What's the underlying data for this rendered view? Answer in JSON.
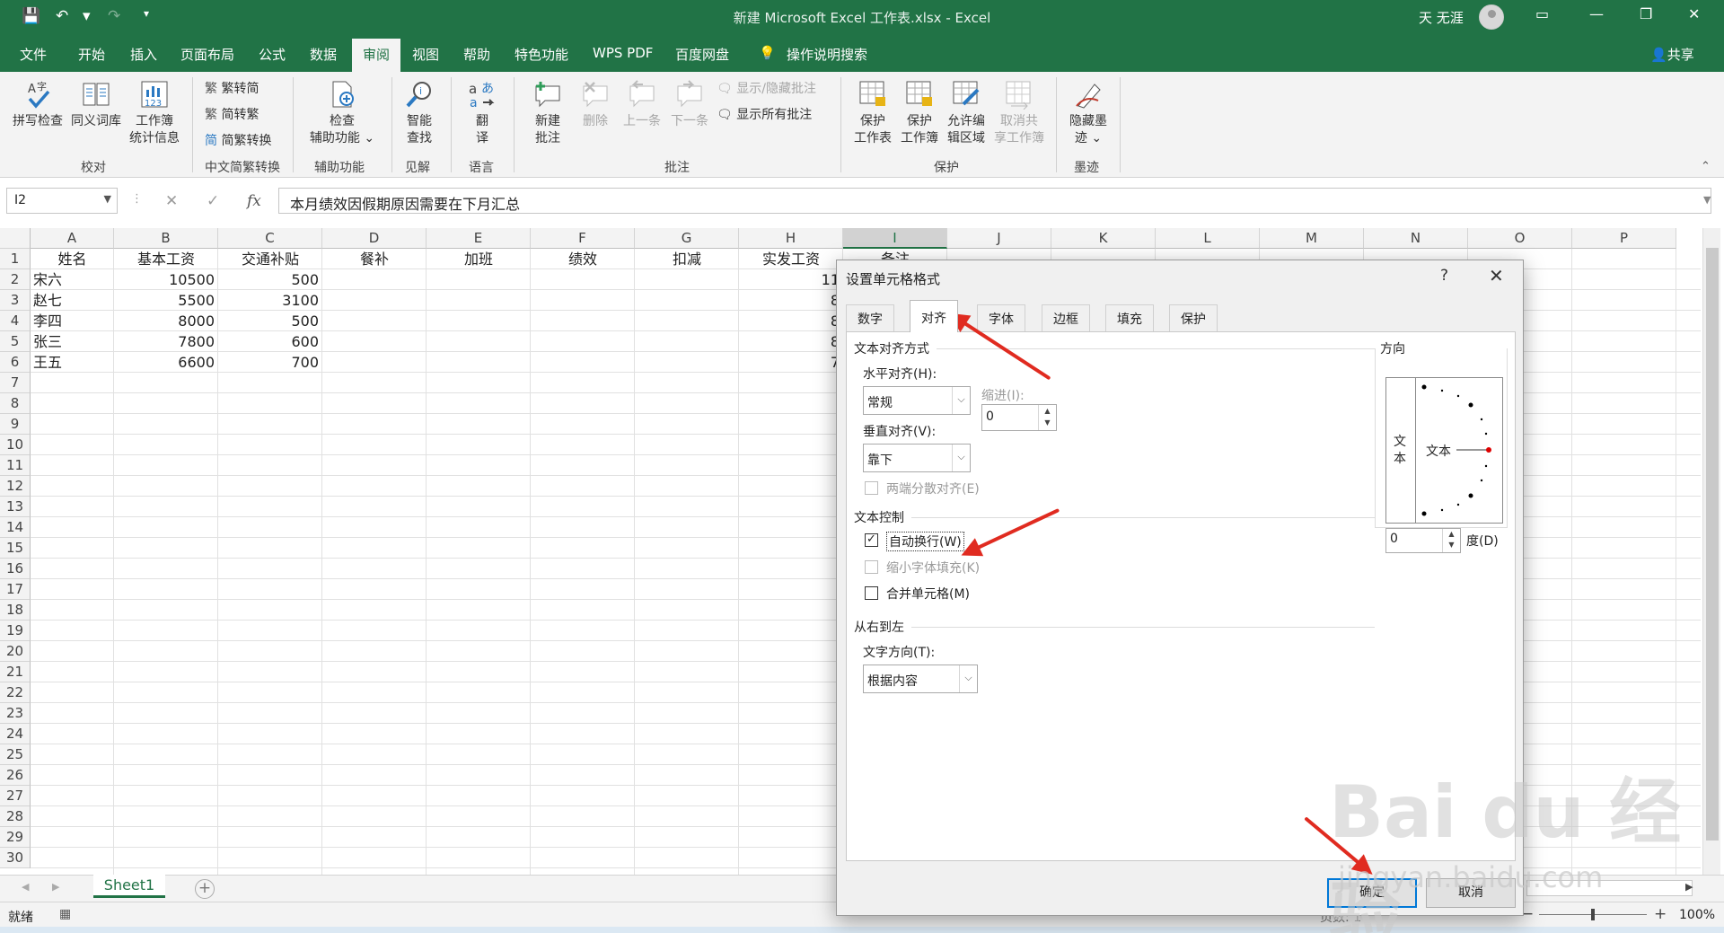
{
  "titlebar": {
    "title": "新建 Microsoft Excel 工作表.xlsx  -  Excel",
    "user": "天 无涯",
    "save_icon": "save-icon",
    "undo_icon": "undo-icon",
    "redo_icon": "redo-icon"
  },
  "menu": {
    "tabs": [
      "文件",
      "开始",
      "插入",
      "页面布局",
      "公式",
      "数据",
      "审阅",
      "视图",
      "帮助",
      "特色功能",
      "WPS PDF",
      "百度网盘"
    ],
    "active": "审阅",
    "tell_me": "操作说明搜索",
    "share": "共享"
  },
  "ribbon": {
    "proofing": {
      "spell": "拼写检查",
      "thesaurus": "同义词库",
      "stats_line1": "工作簿",
      "stats_line2": "统计信息",
      "group": "校对"
    },
    "chinese": {
      "t2s": "繁转简",
      "s2t": "简转繁",
      "convert": "简繁转换",
      "group": "中文简繁转换"
    },
    "access": {
      "line1": "检查",
      "line2": "辅助功能 ⌄",
      "group": "辅助功能"
    },
    "insights": {
      "line1": "智能",
      "line2": "查找",
      "group": "见解"
    },
    "language": {
      "line1": "翻",
      "line2": "译",
      "group": "语言"
    },
    "comments": {
      "new1": "新建",
      "new2": "批注",
      "delete": "删除",
      "prev": "上一条",
      "next": "下一条",
      "toggle": "显示/隐藏批注",
      "showall": "显示所有批注",
      "group": "批注"
    },
    "protect": {
      "sheet1": "保护",
      "sheet2": "工作表",
      "book1": "保护",
      "book2": "工作簿",
      "edit1": "允许编",
      "edit2": "辑区域",
      "unshare1": "取消共",
      "unshare2": "享工作簿",
      "group": "保护"
    },
    "ink": {
      "line1": "隐藏墨",
      "line2": "迹 ⌄",
      "group": "墨迹"
    }
  },
  "formula_bar": {
    "name_box": "I2",
    "cancel": "✕",
    "enter": "✓",
    "fx": "fx",
    "content": "本月绩效因假期原因需要在下月汇总"
  },
  "sheet": {
    "columns": [
      "A",
      "B",
      "C",
      "D",
      "E",
      "F",
      "G",
      "H",
      "I",
      "J",
      "K",
      "L",
      "M",
      "N",
      "O",
      "P"
    ],
    "headers": [
      "姓名",
      "基本工资",
      "交通补贴",
      "餐补",
      "加班",
      "绩效",
      "扣减",
      "实发工资",
      "备注"
    ],
    "rows": [
      [
        "宋六",
        "10500",
        "500",
        "11"
      ],
      [
        "赵七",
        "5500",
        "3100",
        "8"
      ],
      [
        "李四",
        "8000",
        "500",
        "8"
      ],
      [
        "张三",
        "7800",
        "600",
        "8"
      ],
      [
        "王五",
        "6600",
        "700",
        "7"
      ]
    ],
    "row_numbers": [
      "1",
      "2",
      "3",
      "4",
      "5",
      "6",
      "7",
      "8",
      "9",
      "10",
      "11",
      "12",
      "13",
      "14",
      "15",
      "16",
      "17",
      "18",
      "19",
      "20",
      "21",
      "22",
      "23",
      "24",
      "25",
      "26",
      "27",
      "28",
      "29",
      "30"
    ]
  },
  "sheet_tabs": {
    "active": "Sheet1",
    "add": "+"
  },
  "status": {
    "ready": "就绪",
    "page": "页数: 1",
    "zoom": "100%"
  },
  "dialog": {
    "title": "设置单元格格式",
    "help": "?",
    "close": "✕",
    "tabs": [
      "数字",
      "对齐",
      "字体",
      "边框",
      "填充",
      "保护"
    ],
    "active_tab": "对齐",
    "text_align": {
      "section": "文本对齐方式",
      "horizontal_label": "水平对齐(H):",
      "horizontal_value": "常规",
      "indent_label": "缩进(I):",
      "indent_value": "0",
      "vertical_label": "垂直对齐(V):",
      "vertical_value": "靠下",
      "distributed": "两端分散对齐(E)"
    },
    "text_control": {
      "section": "文本控制",
      "wrap": "自动换行(W)",
      "wrap_checked": true,
      "shrink": "缩小字体填充(K)",
      "merge": "合并单元格(M)"
    },
    "rtl": {
      "section": "从右到左",
      "direction_label": "文字方向(T):",
      "direction_value": "根据内容"
    },
    "orientation": {
      "section": "方向",
      "vertical_text": "文本",
      "dial_text": "文本",
      "degree_value": "0",
      "degree_label": "度(D)"
    },
    "ok": "确定",
    "cancel": "取消"
  },
  "watermark": {
    "logo": "Bai du 经验",
    "url": "jingyan.baidu.com"
  },
  "colors": {
    "excel_green": "#217346",
    "annotation_red": "#e02b20",
    "focus_blue": "#0078d7"
  }
}
